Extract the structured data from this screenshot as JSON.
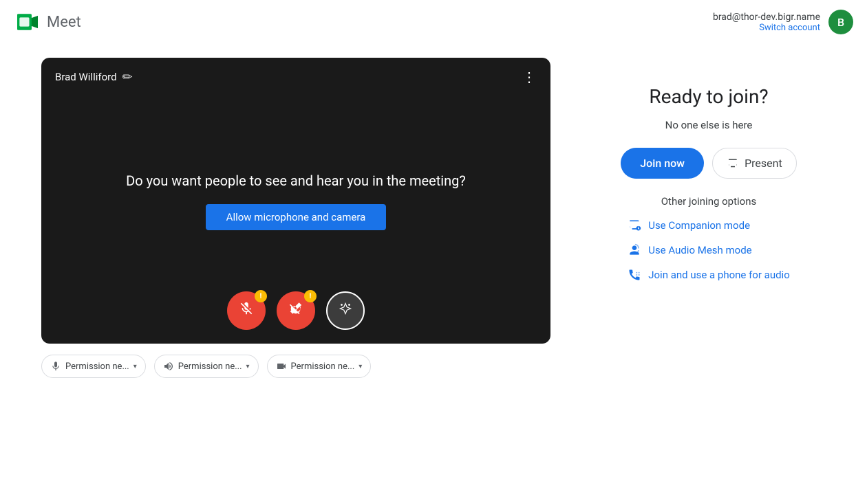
{
  "header": {
    "logo_text": "Meet",
    "account_email": "brad@thor-dev.bigr.name",
    "account_switch": "Switch account",
    "avatar_letter": "B"
  },
  "video_preview": {
    "username": "Brad Williford",
    "question": "Do you want people to see and hear you in the meeting?",
    "allow_btn_label": "Allow microphone and camera",
    "controls": {
      "mic_label": "Microphone off",
      "camera_label": "Camera off",
      "effects_label": "Apply visual effects"
    }
  },
  "permissions": {
    "mic": "Permission ne...",
    "speaker": "Permission ne...",
    "camera": "Permission ne..."
  },
  "right_panel": {
    "ready_title": "Ready to join?",
    "no_one_text": "No one else is here",
    "join_now_label": "Join now",
    "present_label": "Present",
    "other_options_title": "Other joining options",
    "companion_label": "Use Companion mode",
    "audio_mesh_label": "Use Audio Mesh mode",
    "phone_label": "Join and use a phone for audio"
  }
}
